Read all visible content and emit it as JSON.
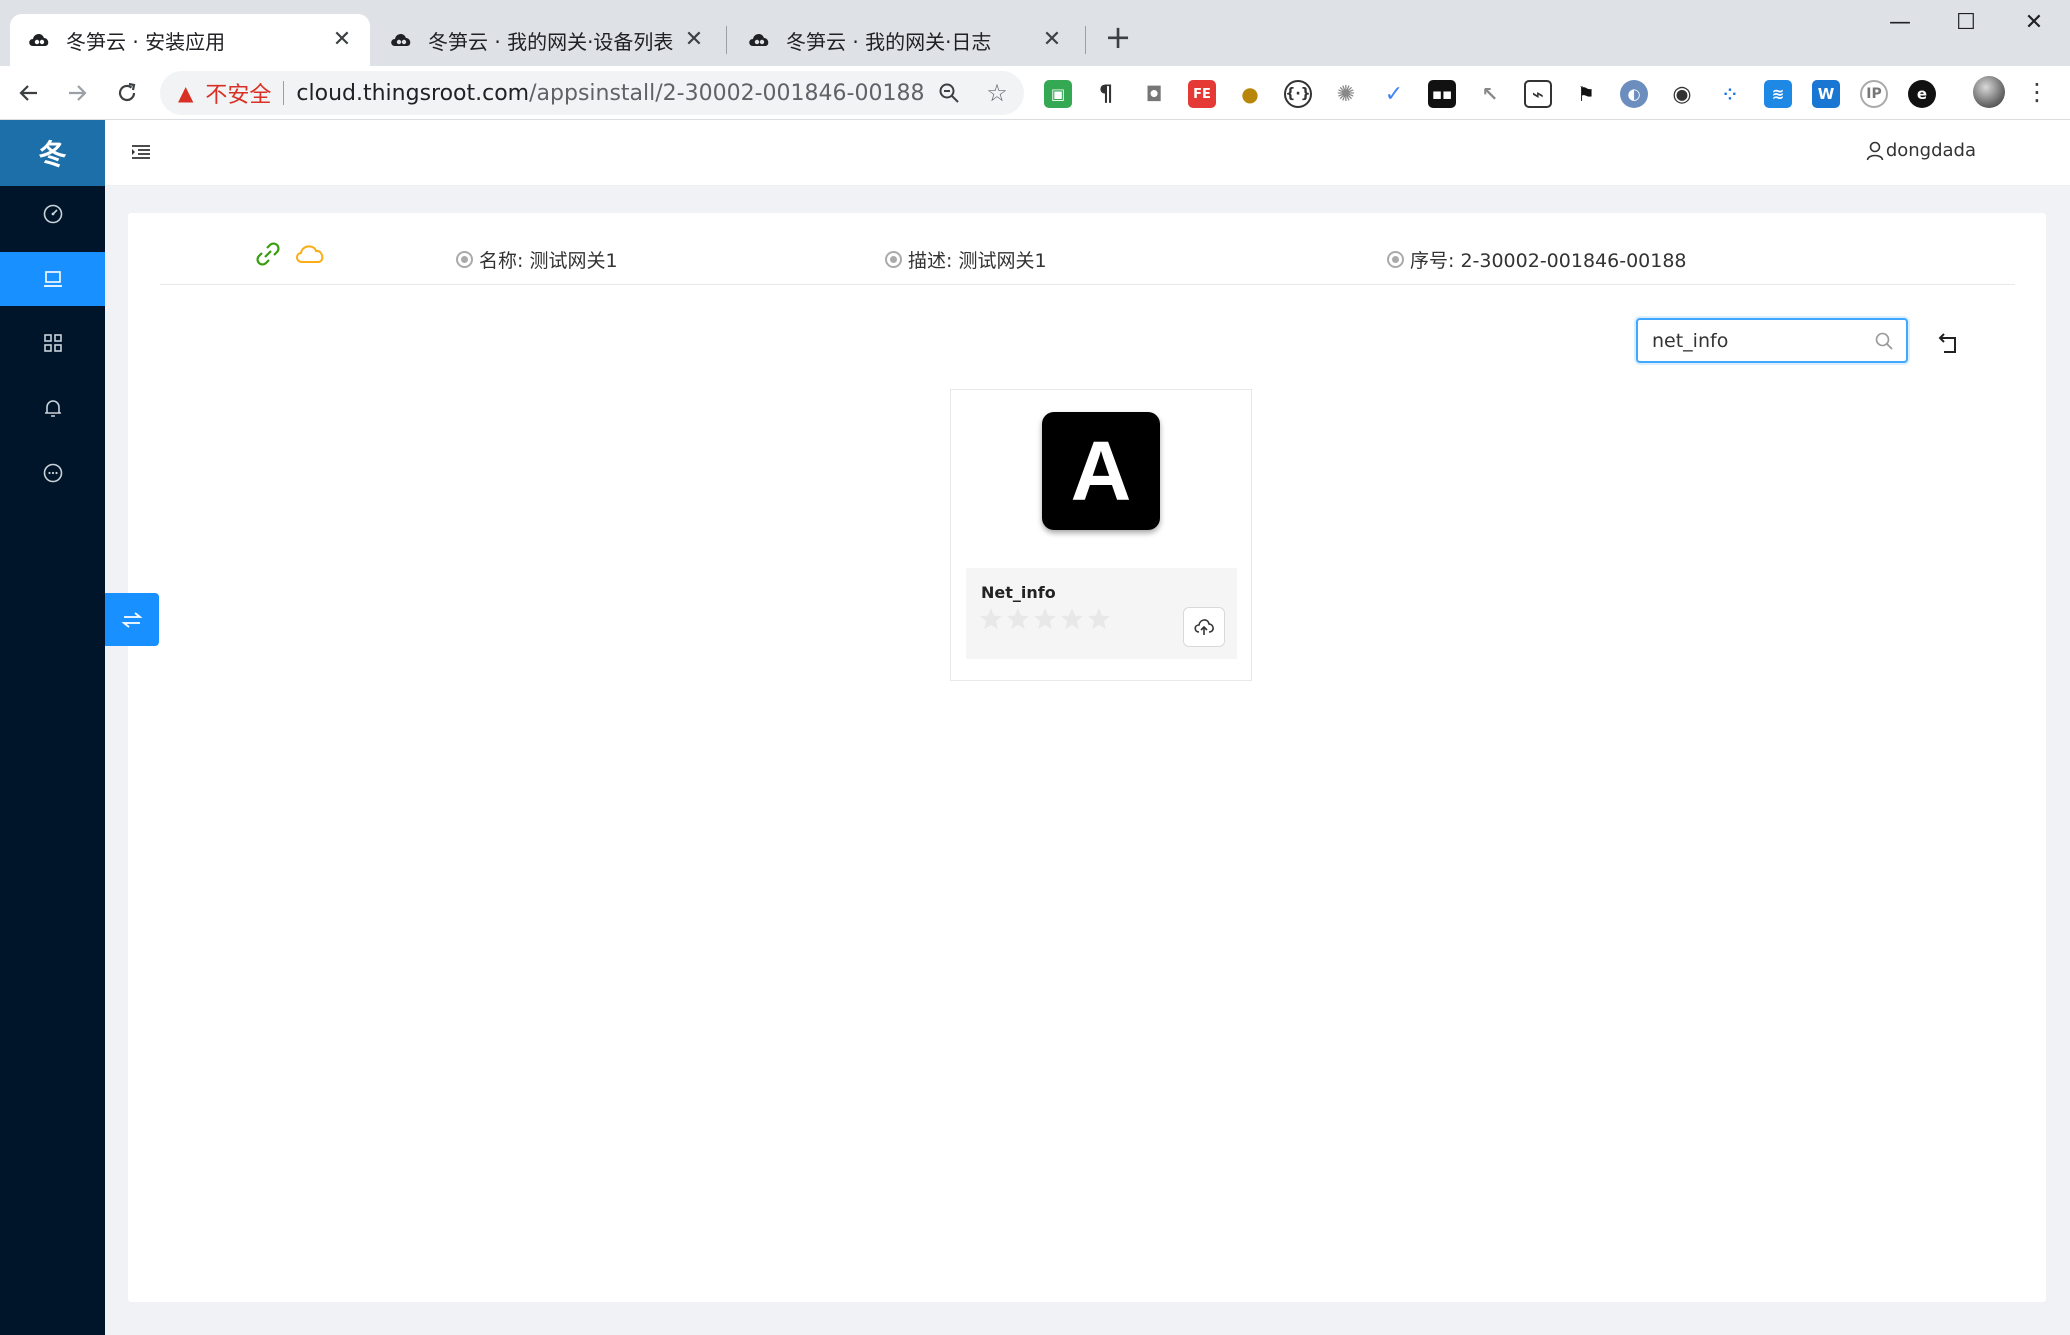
{
  "browser": {
    "tabs": [
      {
        "title": "冬笋云 · 安装应用",
        "active": true
      },
      {
        "title": "冬笋云 · 我的网关·设备列表",
        "active": false
      },
      {
        "title": "冬笋云 · 我的网关·日志",
        "active": false
      }
    ],
    "new_tab": "+",
    "window_controls": {
      "minimize": "—",
      "maximize": "☐",
      "close": "✕"
    },
    "address": {
      "security_label": "不安全",
      "host": "cloud.thingsroot.com",
      "path": "/appsinstall/2-30002-001846-00188"
    },
    "extensions": [
      "chrome-store-icon",
      "paragraph-icon",
      "camera-icon",
      "fe-icon",
      "cookie-icon",
      "json-icon",
      "gear-icon",
      "check-icon",
      "bitwarden-icon",
      "cursor-icon",
      "image-icon",
      "translate-icon",
      "circle-icon",
      "eye-icon",
      "dots-icon",
      "wave-icon",
      "w-icon",
      "ip-icon",
      "edge-icon"
    ]
  },
  "app": {
    "logo_text": "冬",
    "sidebar_items": [
      "dashboard-icon",
      "laptop-icon",
      "appstore-icon",
      "bell-icon",
      "message-icon"
    ],
    "active_sidebar_index": 1,
    "username": "dongdada",
    "gateway": {
      "name": "名称: 测试网关1",
      "desc": "描述: 测试网关1",
      "serial": "序号: 2-30002-001846-00188"
    },
    "search_value": "net_info",
    "apps": [
      {
        "icon_letter": "A",
        "name": "Net_info",
        "rating": 0,
        "max_rating": 5
      }
    ]
  },
  "colors": {
    "sidebar": "#001529",
    "logo_bg": "#1d6fa9",
    "primary": "#1890ff",
    "link_green": "#389e0d",
    "cloud_orange": "#faad14",
    "insecure_red": "#d93025"
  }
}
